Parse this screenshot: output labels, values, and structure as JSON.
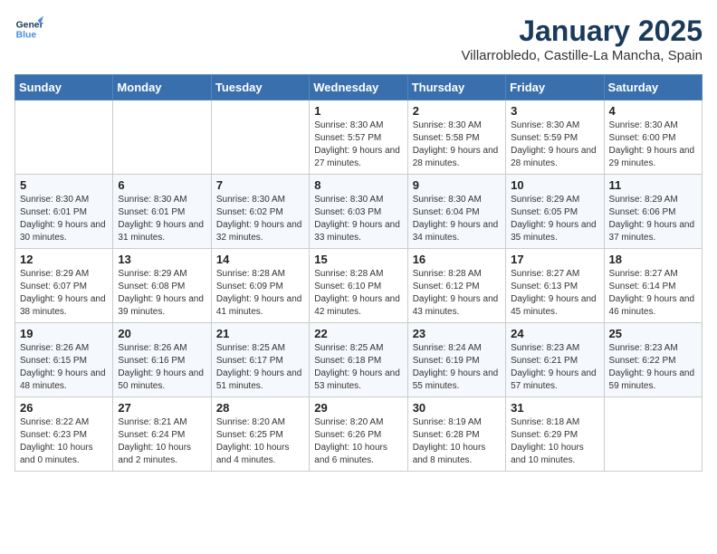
{
  "logo": {
    "line1": "General",
    "line2": "Blue"
  },
  "header": {
    "month": "January 2025",
    "location": "Villarrobledo, Castille-La Mancha, Spain"
  },
  "weekdays": [
    "Sunday",
    "Monday",
    "Tuesday",
    "Wednesday",
    "Thursday",
    "Friday",
    "Saturday"
  ],
  "rows": [
    [
      {
        "day": "",
        "info": ""
      },
      {
        "day": "",
        "info": ""
      },
      {
        "day": "",
        "info": ""
      },
      {
        "day": "1",
        "info": "Sunrise: 8:30 AM\nSunset: 5:57 PM\nDaylight: 9 hours and 27 minutes."
      },
      {
        "day": "2",
        "info": "Sunrise: 8:30 AM\nSunset: 5:58 PM\nDaylight: 9 hours and 28 minutes."
      },
      {
        "day": "3",
        "info": "Sunrise: 8:30 AM\nSunset: 5:59 PM\nDaylight: 9 hours and 28 minutes."
      },
      {
        "day": "4",
        "info": "Sunrise: 8:30 AM\nSunset: 6:00 PM\nDaylight: 9 hours and 29 minutes."
      }
    ],
    [
      {
        "day": "5",
        "info": "Sunrise: 8:30 AM\nSunset: 6:01 PM\nDaylight: 9 hours and 30 minutes."
      },
      {
        "day": "6",
        "info": "Sunrise: 8:30 AM\nSunset: 6:01 PM\nDaylight: 9 hours and 31 minutes."
      },
      {
        "day": "7",
        "info": "Sunrise: 8:30 AM\nSunset: 6:02 PM\nDaylight: 9 hours and 32 minutes."
      },
      {
        "day": "8",
        "info": "Sunrise: 8:30 AM\nSunset: 6:03 PM\nDaylight: 9 hours and 33 minutes."
      },
      {
        "day": "9",
        "info": "Sunrise: 8:30 AM\nSunset: 6:04 PM\nDaylight: 9 hours and 34 minutes."
      },
      {
        "day": "10",
        "info": "Sunrise: 8:29 AM\nSunset: 6:05 PM\nDaylight: 9 hours and 35 minutes."
      },
      {
        "day": "11",
        "info": "Sunrise: 8:29 AM\nSunset: 6:06 PM\nDaylight: 9 hours and 37 minutes."
      }
    ],
    [
      {
        "day": "12",
        "info": "Sunrise: 8:29 AM\nSunset: 6:07 PM\nDaylight: 9 hours and 38 minutes."
      },
      {
        "day": "13",
        "info": "Sunrise: 8:29 AM\nSunset: 6:08 PM\nDaylight: 9 hours and 39 minutes."
      },
      {
        "day": "14",
        "info": "Sunrise: 8:28 AM\nSunset: 6:09 PM\nDaylight: 9 hours and 41 minutes."
      },
      {
        "day": "15",
        "info": "Sunrise: 8:28 AM\nSunset: 6:10 PM\nDaylight: 9 hours and 42 minutes."
      },
      {
        "day": "16",
        "info": "Sunrise: 8:28 AM\nSunset: 6:12 PM\nDaylight: 9 hours and 43 minutes."
      },
      {
        "day": "17",
        "info": "Sunrise: 8:27 AM\nSunset: 6:13 PM\nDaylight: 9 hours and 45 minutes."
      },
      {
        "day": "18",
        "info": "Sunrise: 8:27 AM\nSunset: 6:14 PM\nDaylight: 9 hours and 46 minutes."
      }
    ],
    [
      {
        "day": "19",
        "info": "Sunrise: 8:26 AM\nSunset: 6:15 PM\nDaylight: 9 hours and 48 minutes."
      },
      {
        "day": "20",
        "info": "Sunrise: 8:26 AM\nSunset: 6:16 PM\nDaylight: 9 hours and 50 minutes."
      },
      {
        "day": "21",
        "info": "Sunrise: 8:25 AM\nSunset: 6:17 PM\nDaylight: 9 hours and 51 minutes."
      },
      {
        "day": "22",
        "info": "Sunrise: 8:25 AM\nSunset: 6:18 PM\nDaylight: 9 hours and 53 minutes."
      },
      {
        "day": "23",
        "info": "Sunrise: 8:24 AM\nSunset: 6:19 PM\nDaylight: 9 hours and 55 minutes."
      },
      {
        "day": "24",
        "info": "Sunrise: 8:23 AM\nSunset: 6:21 PM\nDaylight: 9 hours and 57 minutes."
      },
      {
        "day": "25",
        "info": "Sunrise: 8:23 AM\nSunset: 6:22 PM\nDaylight: 9 hours and 59 minutes."
      }
    ],
    [
      {
        "day": "26",
        "info": "Sunrise: 8:22 AM\nSunset: 6:23 PM\nDaylight: 10 hours and 0 minutes."
      },
      {
        "day": "27",
        "info": "Sunrise: 8:21 AM\nSunset: 6:24 PM\nDaylight: 10 hours and 2 minutes."
      },
      {
        "day": "28",
        "info": "Sunrise: 8:20 AM\nSunset: 6:25 PM\nDaylight: 10 hours and 4 minutes."
      },
      {
        "day": "29",
        "info": "Sunrise: 8:20 AM\nSunset: 6:26 PM\nDaylight: 10 hours and 6 minutes."
      },
      {
        "day": "30",
        "info": "Sunrise: 8:19 AM\nSunset: 6:28 PM\nDaylight: 10 hours and 8 minutes."
      },
      {
        "day": "31",
        "info": "Sunrise: 8:18 AM\nSunset: 6:29 PM\nDaylight: 10 hours and 10 minutes."
      },
      {
        "day": "",
        "info": ""
      }
    ]
  ]
}
